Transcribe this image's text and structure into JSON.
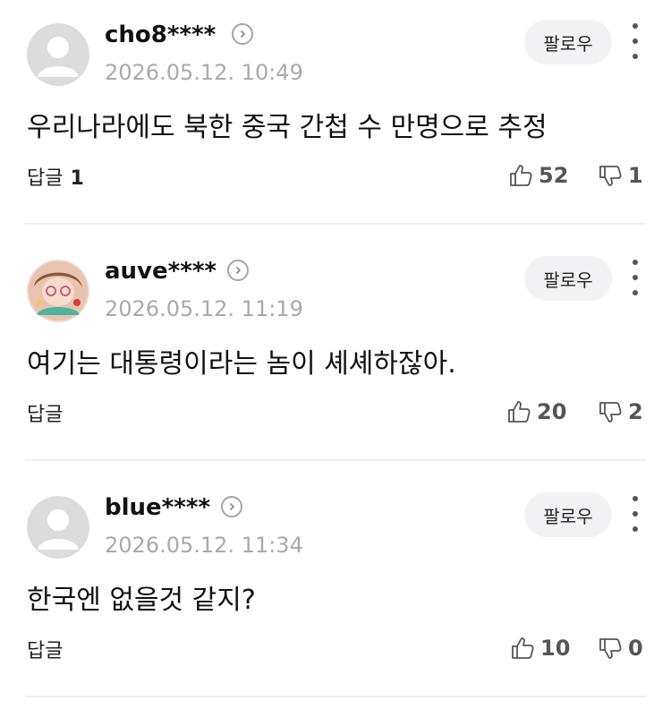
{
  "comments": [
    {
      "username": "cho8****",
      "timestamp": "2026.05.12. 10:49",
      "text": "우리나라에도 북한 중국 간첩 수 만명으로 추정",
      "reply_label": "답글",
      "reply_count": "1",
      "likes": "52",
      "dislikes": "1",
      "follow_label": "팔로우",
      "avatar": "default-avatar"
    },
    {
      "username": "auve****",
      "timestamp": "2026.05.12. 11:19",
      "text": "여기는 대통령이라는 놈이 셰셰하잖아.",
      "reply_label": "답글",
      "likes": "20",
      "dislikes": "2",
      "follow_label": "팔로우",
      "avatar": "profile-photo"
    },
    {
      "username": "blue****",
      "timestamp": "2026.05.12. 11:34",
      "text": "한국엔 없을것 같지?",
      "reply_label": "답글",
      "likes": "10",
      "dislikes": "0",
      "follow_label": "팔로우",
      "avatar": "default-avatar"
    }
  ],
  "colors": {
    "text": "#111111",
    "muted": "#aaaaaa",
    "follow_bg": "#f3f3f5",
    "divider": "#eeeeee",
    "avatar_bg": "#dcdcdc"
  }
}
